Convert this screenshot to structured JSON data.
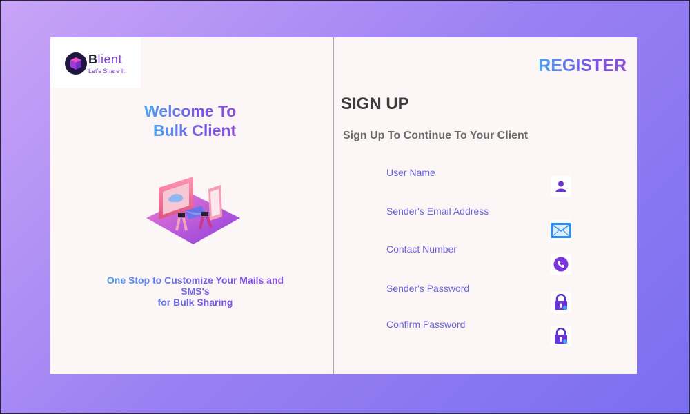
{
  "brand": {
    "logo_letter": "B",
    "logo_rest": "lient",
    "tagline": "Let's Share It"
  },
  "welcome": {
    "line1": "Welcome To",
    "line2": "Bulk Client"
  },
  "description": {
    "line1": "One Stop to Customize Your Mails and SMS's",
    "line2": "for Bulk Sharing"
  },
  "header": {
    "register_label": "REGISTER"
  },
  "form": {
    "title": "SIGN UP",
    "subtitle": "Sign Up To Continue To Your Client",
    "fields": [
      {
        "label": "User Name",
        "icon": "user-icon"
      },
      {
        "label": "Sender's Email Address",
        "icon": "mail-icon"
      },
      {
        "label": "Contact Number",
        "icon": "phone-icon"
      },
      {
        "label": "Sender's Password",
        "icon": "lock-icon"
      },
      {
        "label": "Confirm Password",
        "icon": "lock-icon"
      }
    ]
  },
  "colors": {
    "background_start": "#c9a4f7",
    "background_end": "#7a6ef0",
    "panel": "#fcf7f6",
    "accent_blue": "#4aa3f2",
    "accent_purple": "#7a55e6",
    "label": "#6c64d8"
  }
}
